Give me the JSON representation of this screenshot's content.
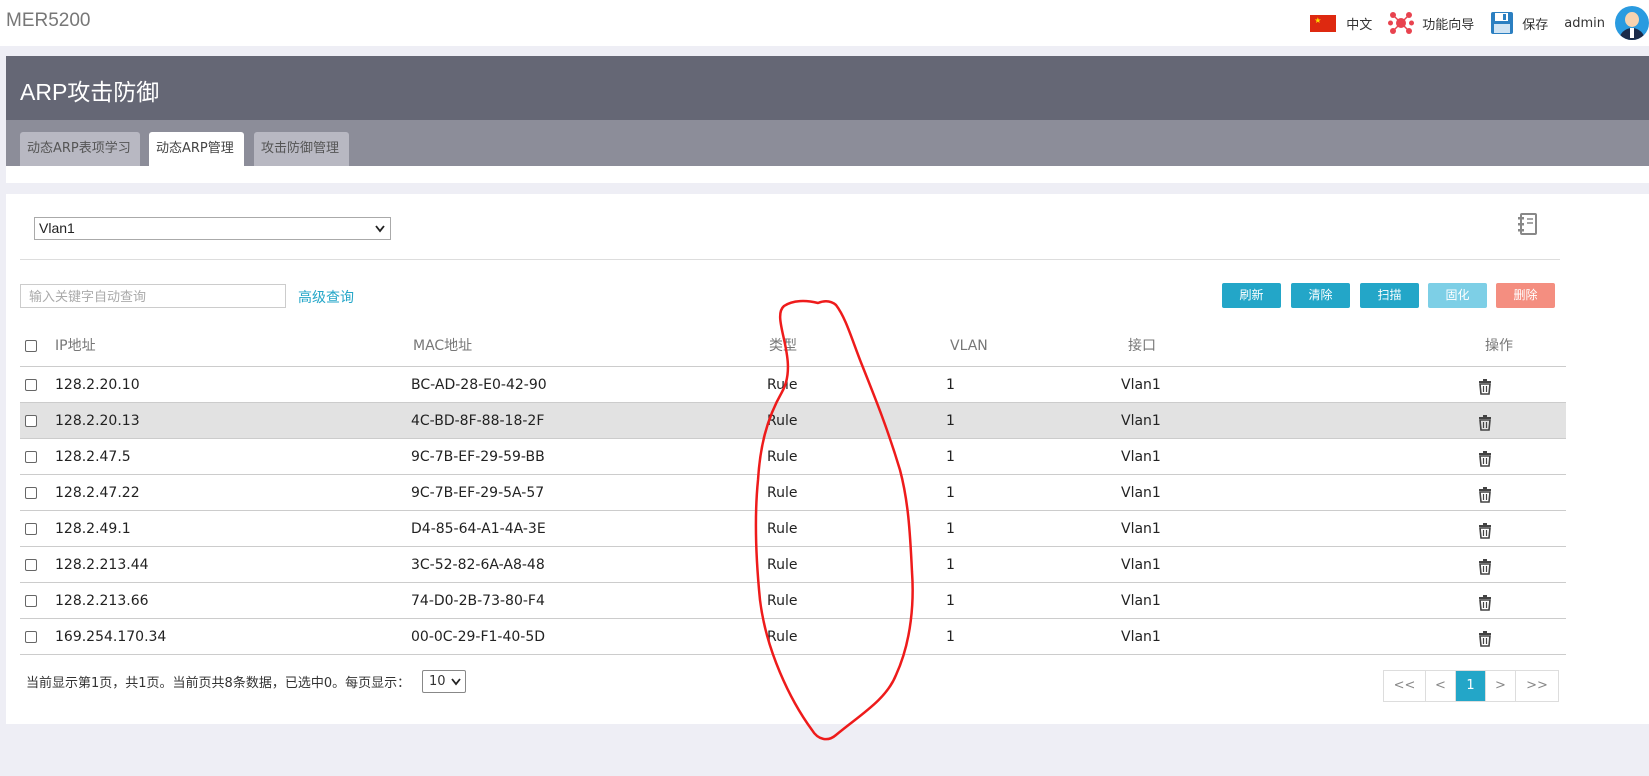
{
  "app": {
    "title": "MER5200"
  },
  "topbar": {
    "language": "中文",
    "wizard": "功能向导",
    "save": "保存",
    "user": "admin"
  },
  "page": {
    "title": "ARP攻击防御",
    "tabs": [
      {
        "label": "动态ARP表项学习",
        "active": false
      },
      {
        "label": "动态ARP管理",
        "active": true
      },
      {
        "label": "攻击防御管理",
        "active": false
      }
    ]
  },
  "filter": {
    "vlan_selected": "Vlan1",
    "search_placeholder": "输入关键字自动查询",
    "advanced_query": "高级查询"
  },
  "buttons": {
    "refresh": "刷新",
    "clear": "清除",
    "scan": "扫描",
    "fix": "固化",
    "delete": "删除"
  },
  "colors": {
    "accent": "#23a6c8",
    "fix_disabled": "#7dcfe6",
    "delete_disabled": "#f48e80",
    "header_bar": "#656775",
    "annotation_red": "#ee1b1b"
  },
  "table": {
    "headers": {
      "ip": "IP地址",
      "mac": "MAC地址",
      "type": "类型",
      "vlan": "VLAN",
      "iface": "接口",
      "ops": "操作"
    },
    "rows": [
      {
        "ip": "128.2.20.10",
        "mac": "BC-AD-28-E0-42-90",
        "type": "Rule",
        "vlan": "1",
        "iface": "Vlan1"
      },
      {
        "ip": "128.2.20.13",
        "mac": "4C-BD-8F-88-18-2F",
        "type": "Rule",
        "vlan": "1",
        "iface": "Vlan1"
      },
      {
        "ip": "128.2.47.5",
        "mac": "9C-7B-EF-29-59-BB",
        "type": "Rule",
        "vlan": "1",
        "iface": "Vlan1"
      },
      {
        "ip": "128.2.47.22",
        "mac": "9C-7B-EF-29-5A-57",
        "type": "Rule",
        "vlan": "1",
        "iface": "Vlan1"
      },
      {
        "ip": "128.2.49.1",
        "mac": "D4-85-64-A1-4A-3E",
        "type": "Rule",
        "vlan": "1",
        "iface": "Vlan1"
      },
      {
        "ip": "128.2.213.44",
        "mac": "3C-52-82-6A-A8-48",
        "type": "Rule",
        "vlan": "1",
        "iface": "Vlan1"
      },
      {
        "ip": "128.2.213.66",
        "mac": "74-D0-2B-73-80-F4",
        "type": "Rule",
        "vlan": "1",
        "iface": "Vlan1"
      },
      {
        "ip": "169.254.170.34",
        "mac": "00-0C-29-F1-40-5D",
        "type": "Rule",
        "vlan": "1",
        "iface": "Vlan1"
      }
    ]
  },
  "pagination": {
    "summary": "当前显示第1页，共1页。当前页共8条数据，已选中0。每页显示：",
    "per_page": "10",
    "first": "<<",
    "prev": "<",
    "current": "1",
    "next": ">",
    "last": ">>"
  }
}
